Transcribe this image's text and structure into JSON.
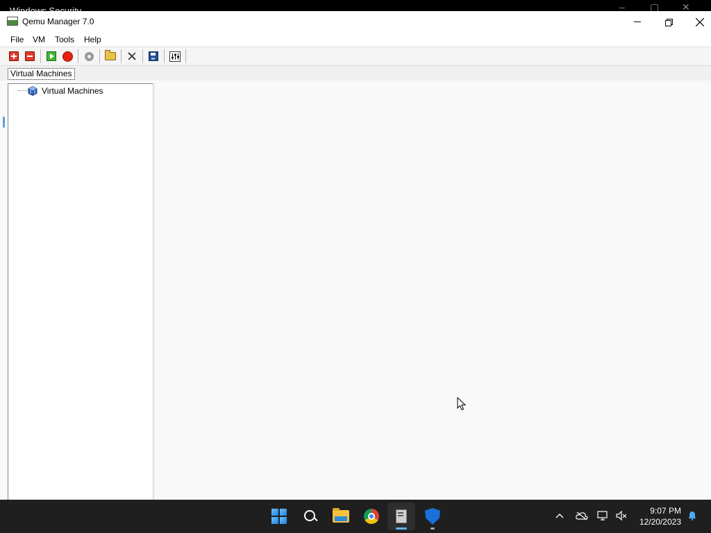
{
  "background_window": {
    "title": "Windows Security"
  },
  "window": {
    "title": "Qemu Manager 7.0",
    "controls": {
      "minimize": "minimize",
      "maximize": "restore",
      "close": "close"
    }
  },
  "menu": {
    "items": [
      "File",
      "VM",
      "Tools",
      "Help"
    ]
  },
  "toolbar": {
    "buttons": [
      {
        "icon": "add-vm-icon"
      },
      {
        "icon": "remove-vm-icon"
      },
      {
        "icon": "start-icon"
      },
      {
        "icon": "stop-icon"
      },
      {
        "icon": "disc-icon"
      },
      {
        "icon": "open-folder-icon"
      },
      {
        "icon": "tools-icon"
      },
      {
        "icon": "save-icon"
      },
      {
        "icon": "settings-mixer-icon"
      }
    ]
  },
  "tabs": {
    "active": "Virtual Machines"
  },
  "tree": {
    "root_label": "Virtual Machines"
  },
  "taskbar": {
    "apps": [
      "start",
      "search",
      "file-explorer",
      "chrome",
      "qemu-manager",
      "windows-security"
    ],
    "clock": {
      "time": "9:07 PM",
      "date": "12/20/2023"
    }
  }
}
